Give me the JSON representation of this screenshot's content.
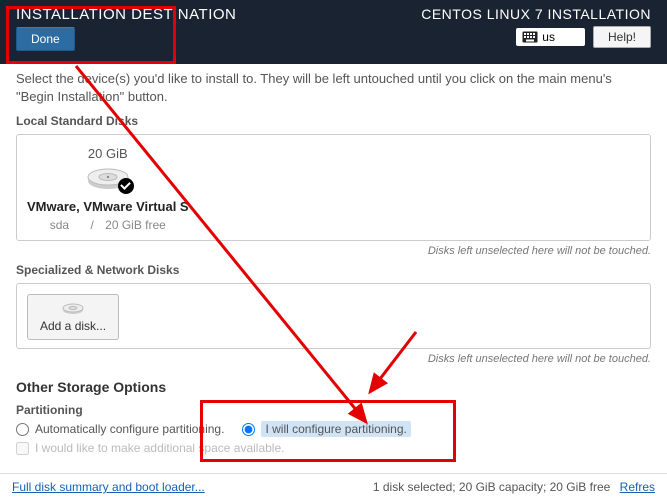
{
  "header": {
    "page_title": "INSTALLATION DESTINATION",
    "done_label": "Done",
    "installer_title": "CENTOS LINUX 7 INSTALLATION",
    "keyboard_layout": "us",
    "help_label": "Help!"
  },
  "intro": {
    "text": "Select the device(s) you'd like to install to. They will be left untouched until you click on the main menu's \"Begin Installation\" button."
  },
  "local_disks": {
    "title": "Local Standard Disks",
    "disk": {
      "size": "20 GiB",
      "name": "VMware, VMware Virtual S",
      "device": "sda",
      "separator": "/",
      "free": "20 GiB free"
    },
    "hint": "Disks left unselected here will not be touched."
  },
  "network_disks": {
    "title": "Specialized & Network Disks",
    "add_label": "Add a disk...",
    "hint": "Disks left unselected here will not be touched."
  },
  "other": {
    "title": "Other Storage Options",
    "partitioning_title": "Partitioning",
    "auto_label": "Automatically configure partitioning.",
    "manual_label": "I will configure partitioning.",
    "additional_label": "I would like to make additional space available."
  },
  "footer": {
    "summary_link": "Full disk summary and boot loader...",
    "status": "1 disk selected; 20 GiB capacity; 20 GiB free",
    "refresh_label": "Refres"
  }
}
